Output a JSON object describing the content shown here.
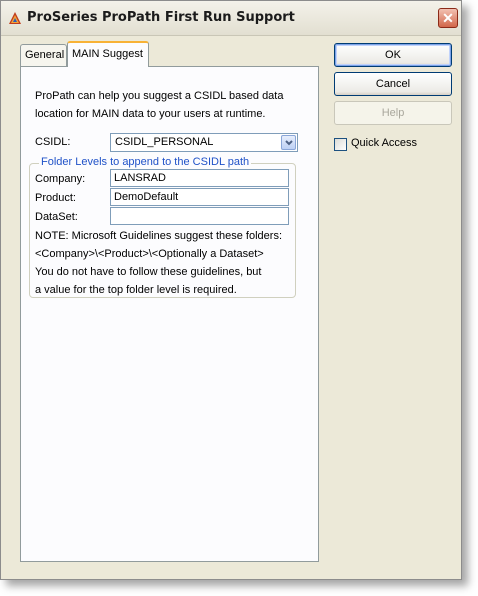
{
  "window": {
    "title": "ProSeries ProPath First Run Support",
    "close_glyph": "✕",
    "icon": "app-logo-icon",
    "close_icon": "close-icon"
  },
  "tabs": [
    {
      "label": "General",
      "active": false
    },
    {
      "label": "MAIN Suggest",
      "active": true
    }
  ],
  "main_suggest": {
    "intro": "ProPath can help you suggest a CSIDL based data location for MAIN data to your users at runtime.",
    "csidl_label": "CSIDL:",
    "csidl_value": "CSIDL_PERSONAL",
    "group_title": "Folder Levels to append to the CSIDL path",
    "company_label": "Company:",
    "company_value": "LANSRAD",
    "product_label": "Product:",
    "product_value": "DemoDefault",
    "dataset_label": "DataSet:",
    "dataset_value": "",
    "note_line1": "NOTE: Microsoft Guidelines suggest these folders:",
    "note_line2": "<Company>\\<Product>\\<Optionally a Dataset>",
    "note_line3": "You do not have to follow these guidelines, but",
    "note_line4": "a value for the top folder level is required."
  },
  "buttons": {
    "ok": "OK",
    "cancel": "Cancel",
    "help": "Help"
  },
  "options": {
    "quick_access_label": "Quick Access",
    "quick_access_checked": false
  },
  "colors": {
    "accent": "#f8b236",
    "group_title": "#2052c8"
  }
}
